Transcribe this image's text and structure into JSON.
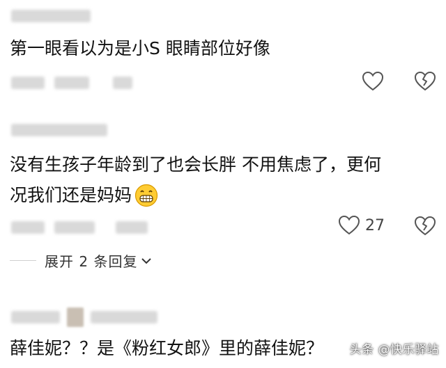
{
  "comments": [
    {
      "content": "第一眼看以为是小S  眼睛部位好像",
      "like_count": ""
    },
    {
      "content_line1": "没有生孩子年龄到了也会长胖  不用焦虑了，更何",
      "content_line2": "况我们还是妈妈",
      "emoji": "😁",
      "like_count": "27",
      "replies_label": "展开 2 条回复",
      "replies_chevron": "⌄"
    },
    {
      "content": "薛佳妮？？是《粉红女郎》里的薛佳妮？"
    }
  ],
  "watermark": "头条 @快乐驿站",
  "icons": [
    "heart-icon",
    "broken-heart-icon",
    "chevron-down-icon",
    "grinning-emoji-icon",
    "avatar"
  ]
}
